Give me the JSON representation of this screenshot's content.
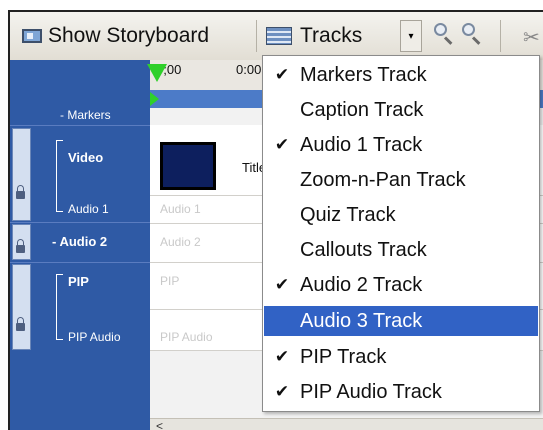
{
  "toolbar": {
    "show_storyboard_label": "Show Storyboard",
    "tracks_label": "Tracks",
    "dropdown_arrow": "▾",
    "icons": [
      "storyboard-icon",
      "tracks-icon",
      "zoom-in-icon",
      "zoom-out-icon",
      "scissors-icon"
    ]
  },
  "ruler": {
    "times": [
      "0;00",
      "0:00"
    ]
  },
  "tracks_panel": {
    "markers_label": "- Markers",
    "video_label": "Video",
    "audio1_label": "Audio 1",
    "audio2_label": "- Audio 2",
    "pip_label": "PIP",
    "pip_audio_label": "PIP Audio"
  },
  "timeline": {
    "audio1_ghost": "Audio 1",
    "audio2_ghost": "Audio 2",
    "pip_ghost": "PIP",
    "pip_audio_ghost": "PIP Audio",
    "clip_title": "Title ("
  },
  "menu": {
    "items": [
      {
        "label": "Markers Track",
        "checked": true,
        "mark": "✔"
      },
      {
        "label": "Caption Track",
        "checked": false,
        "mark": ""
      },
      {
        "label": "Audio 1 Track",
        "checked": true,
        "mark": "✔"
      },
      {
        "label": "Zoom-n-Pan Track",
        "checked": false,
        "mark": ""
      },
      {
        "label": "Quiz Track",
        "checked": false,
        "mark": ""
      },
      {
        "label": "Callouts Track",
        "checked": false,
        "mark": ""
      },
      {
        "label": "Audio 2 Track",
        "checked": true,
        "mark": "✔"
      },
      {
        "label": "Audio 3 Track",
        "checked": false,
        "mark": "",
        "highlighted": true
      },
      {
        "label": "PIP Track",
        "checked": true,
        "mark": "✔"
      },
      {
        "label": "PIP Audio Track",
        "checked": true,
        "mark": "✔"
      }
    ]
  },
  "colors": {
    "track_panel": "#2f5aa5",
    "highlight": "#3162c5",
    "playhead": "#2fd02a"
  }
}
